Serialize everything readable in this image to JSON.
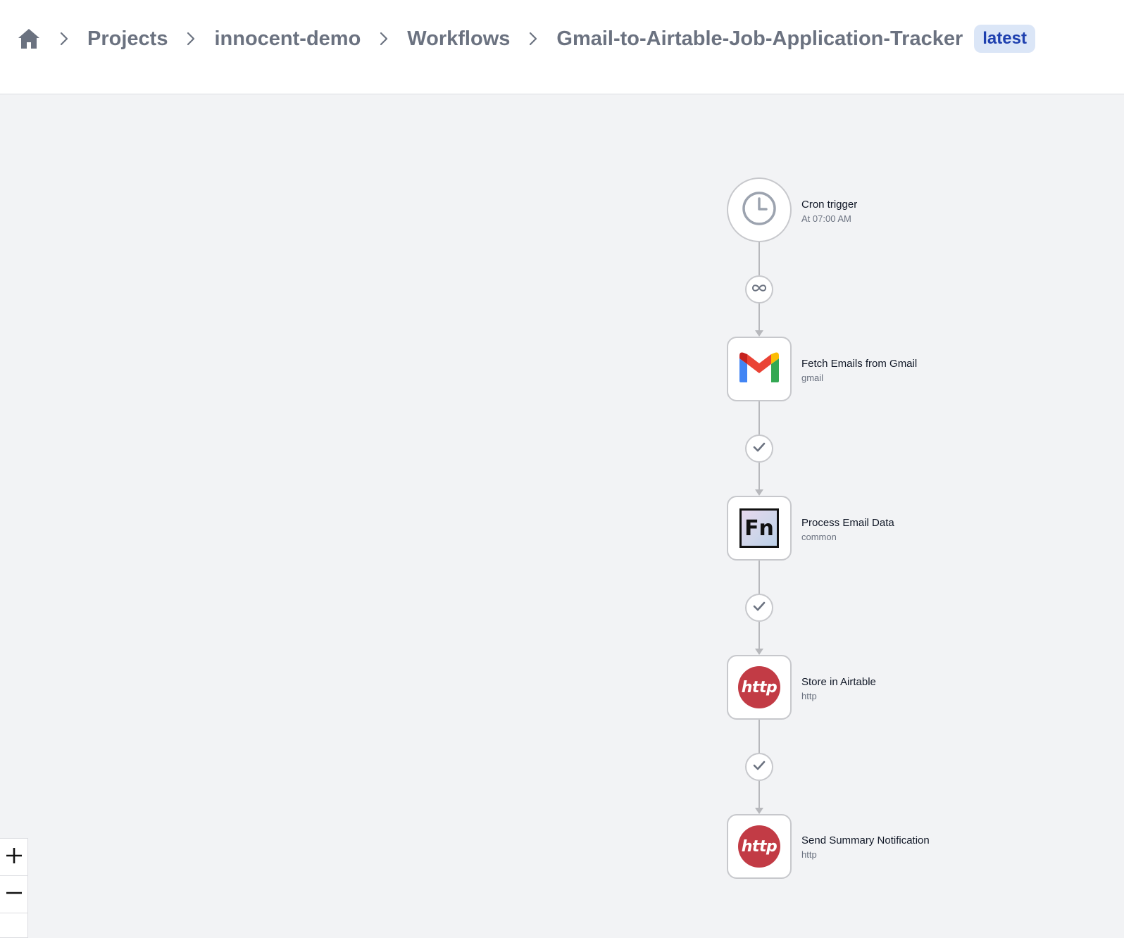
{
  "header": {
    "home_icon": "home-icon",
    "breadcrumbs": [
      {
        "label": "Projects"
      },
      {
        "label": "innocent-demo"
      },
      {
        "label": "Workflows"
      },
      {
        "label": "Gmail-to-Airtable-Job-Application-Tracker"
      }
    ],
    "version_badge": "latest"
  },
  "workflow": {
    "nodes": [
      {
        "title": "Cron trigger",
        "subtitle": "At 07:00 AM",
        "icon": "clock-icon"
      },
      {
        "title": "Fetch Emails from Gmail",
        "subtitle": "gmail",
        "icon": "gmail-icon"
      },
      {
        "title": "Process Email Data",
        "subtitle": "common",
        "icon": "fn-icon",
        "icon_text": "Fn"
      },
      {
        "title": "Store in Airtable",
        "subtitle": "http",
        "icon": "http-icon",
        "icon_text": "http"
      },
      {
        "title": "Send Summary Notification",
        "subtitle": "http",
        "icon": "http-icon",
        "icon_text": "http"
      }
    ],
    "connectors": [
      {
        "icon": "infinity-icon"
      },
      {
        "icon": "check-icon"
      },
      {
        "icon": "check-icon"
      },
      {
        "icon": "check-icon"
      }
    ]
  },
  "zoom_controls": {
    "zoom_in_icon": "plus-icon",
    "zoom_out_icon": "minus-icon"
  },
  "colors": {
    "canvas_bg": "#f2f3f5",
    "breadcrumb_text": "#6b7280",
    "badge_bg": "#dbe6f7",
    "badge_text": "#1e40af",
    "http_red": "#c23b45",
    "node_border": "#c7c8cc"
  }
}
